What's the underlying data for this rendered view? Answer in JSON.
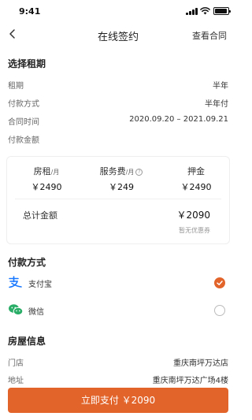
{
  "status_bar": {
    "time": "9:41"
  },
  "nav": {
    "title": "在线签约",
    "action": "查看合同"
  },
  "lease": {
    "section_title": "选择租期",
    "rows": [
      {
        "label": "租期",
        "value": "半年"
      },
      {
        "label": "付款方式",
        "value": "半年付"
      },
      {
        "label": "合同时间",
        "value": "2020.09.20 – 2021.09.21"
      },
      {
        "label": "付款金额",
        "value": ""
      }
    ]
  },
  "fees": {
    "rent_label": "房租",
    "rent_unit": "/月",
    "rent_value": "￥2490",
    "service_label": "服务费",
    "service_unit": "/月",
    "service_help": "?",
    "service_value": "￥249",
    "deposit_label": "押金",
    "deposit_value": "￥2490",
    "total_label": "总计金额",
    "total_value": "￥2090",
    "coupon_note": "暂无优惠券"
  },
  "payment": {
    "section_title": "付款方式",
    "options": [
      {
        "name": "支付宝",
        "icon": "alipay-icon",
        "color": "#1677ff",
        "selected": true
      },
      {
        "name": "微信",
        "icon": "wechat-icon",
        "color": "#2aae67",
        "selected": false
      }
    ]
  },
  "house": {
    "section_title": "房屋信息",
    "rows": [
      {
        "label": "门店",
        "value": "重庆南坪万达店"
      },
      {
        "label": "地址",
        "value": "重庆南坪万达广场4楼"
      }
    ]
  },
  "submit": {
    "label": "立即支付 ￥2090"
  },
  "colors": {
    "accent": "#e2642a"
  }
}
